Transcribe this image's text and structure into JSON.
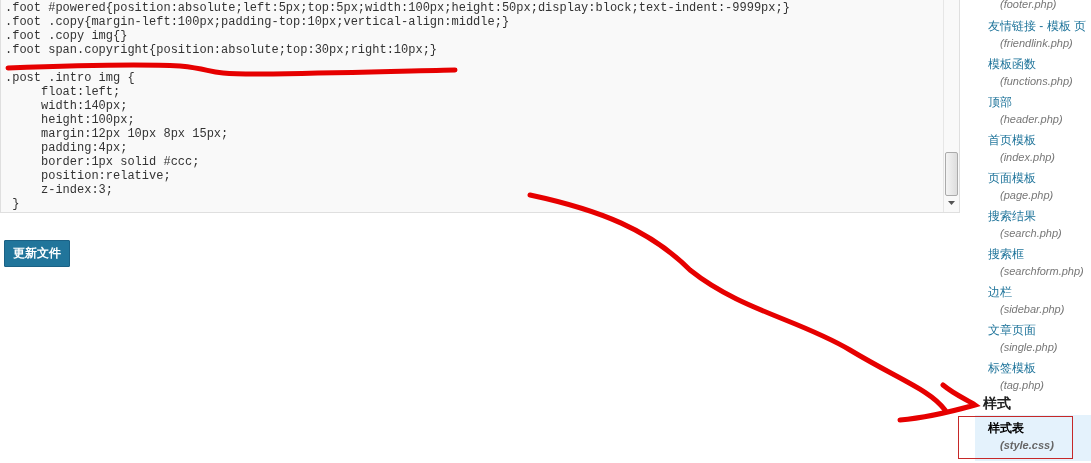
{
  "editor": {
    "blocks": [
      {
        "lines": [
          ".foot #powered{position:absolute;left:5px;top:5px;width:100px;height:50px;display:block;text-indent:-9999px;}",
          ".foot .copy{margin-left:100px;padding-top:10px;vertical-align:middle;}",
          ".foot .copy img{}",
          ".foot span.copyright{position:absolute;top:30px;right:10px;}"
        ]
      },
      {
        "lines": [
          ".post .intro img {",
          "     float:left;",
          "     width:140px;",
          "     height:100px;",
          "     margin:12px 10px 8px 15px;",
          "     padding:4px;",
          "     border:1px solid #ccc;",
          "     position:relative;",
          "     z-index:3;",
          " }"
        ]
      }
    ]
  },
  "update_button": {
    "label": "更新文件"
  },
  "sidebar": {
    "groups": [
      {
        "items": [
          {
            "file": "(footer.php)",
            "selected": false
          },
          {
            "name": "友情链接 - 模板 页",
            "file": "(friendlink.php)",
            "selected": false
          },
          {
            "name": "模板函数",
            "file": "(functions.php)",
            "selected": false
          },
          {
            "name": "顶部",
            "file": "(header.php)",
            "selected": false
          },
          {
            "name": "首页模板",
            "file": "(index.php)",
            "selected": false
          },
          {
            "name": "页面模板",
            "file": "(page.php)",
            "selected": false
          },
          {
            "name": "搜索结果",
            "file": "(search.php)",
            "selected": false
          },
          {
            "name": "搜索框",
            "file": "(searchform.php)",
            "selected": false
          },
          {
            "name": "边栏",
            "file": "(sidebar.php)",
            "selected": false
          },
          {
            "name": "文章页面",
            "file": "(single.php)",
            "selected": false
          },
          {
            "name": "标签模板",
            "file": "(tag.php)",
            "selected": false
          }
        ]
      },
      {
        "heading": "样式",
        "items": [
          {
            "name": "样式表",
            "file": "(style.css)",
            "selected": true
          }
        ]
      }
    ]
  },
  "annotations": [
    {
      "kind": "underline"
    },
    {
      "kind": "arrow"
    },
    {
      "kind": "frame"
    }
  ]
}
